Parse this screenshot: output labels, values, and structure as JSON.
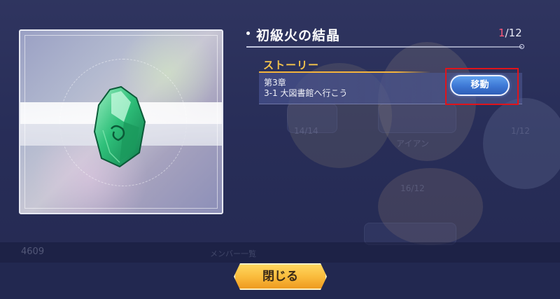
{
  "item": {
    "name": "初級火の結晶",
    "count_current": "1",
    "count_total": "/12",
    "icon": "green-crystal-icon"
  },
  "source": {
    "category": "ストーリー",
    "chapter": "第3章",
    "stage": "3-1 大図書館へ行こう",
    "move_button_label": "移動"
  },
  "close_button_label": "閉じる",
  "background": {
    "count_a": "14/14",
    "count_b": "1/12",
    "count_c": "16/12",
    "character_name": "アイアン",
    "bottom_value": "4609",
    "bottom_caption": "メンバー一覧"
  },
  "colors": {
    "highlight": "#e0141b",
    "story_accent": "#f6c44b",
    "count_current": "#ff5a7a"
  }
}
